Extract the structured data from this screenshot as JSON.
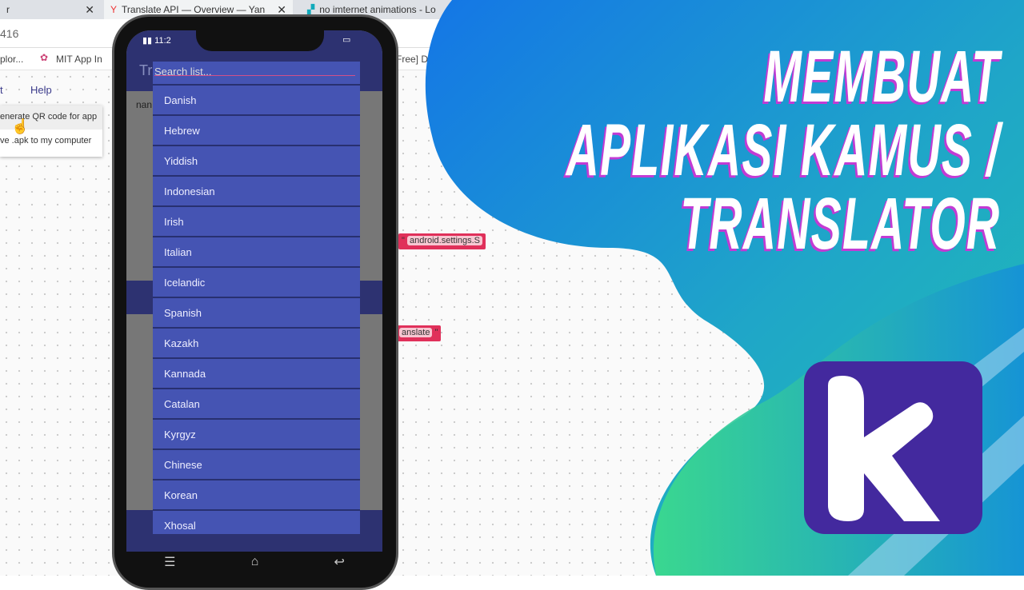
{
  "browser": {
    "tabs": [
      {
        "label": "r"
      },
      {
        "label": "Translate API — Overview — Yan"
      },
      {
        "label": "no imternet animations - Lo"
      }
    ],
    "address": "416",
    "bookmarks": [
      "plor...",
      "MIT App In",
      "Free] D"
    ],
    "menu": {
      "partial": "t",
      "help": "Help"
    },
    "dropdown": [
      "enerate QR code for app",
      "ve .apk to my computer"
    ],
    "blocks": [
      "android.settings.S",
      "anslate"
    ]
  },
  "phone": {
    "status_time": "11:2",
    "app_title": "Tr",
    "label": "nan",
    "search_placeholder": "Search list...",
    "languages": [
      "Danish",
      "Hebrew",
      "Yiddish",
      "Indonesian",
      "Irish",
      "Italian",
      "Icelandic",
      "Spanish",
      "Kazakh",
      "Kannada",
      "Catalan",
      "Kyrgyz",
      "Chinese",
      "Korean",
      "Xhosal"
    ],
    "nav_icons": [
      "menu-icon",
      "home-icon",
      "back-icon"
    ]
  },
  "thumbnail": {
    "title_lines": [
      "MEMBUAT",
      "APLIKASI KAMUS /",
      "TRANSLATOR"
    ],
    "logo_letter": "k",
    "colors": {
      "blue": "#1a7fe0",
      "green": "#3ddc8a",
      "logo": "#43299e",
      "title_shadow": "#c23bd4"
    }
  }
}
